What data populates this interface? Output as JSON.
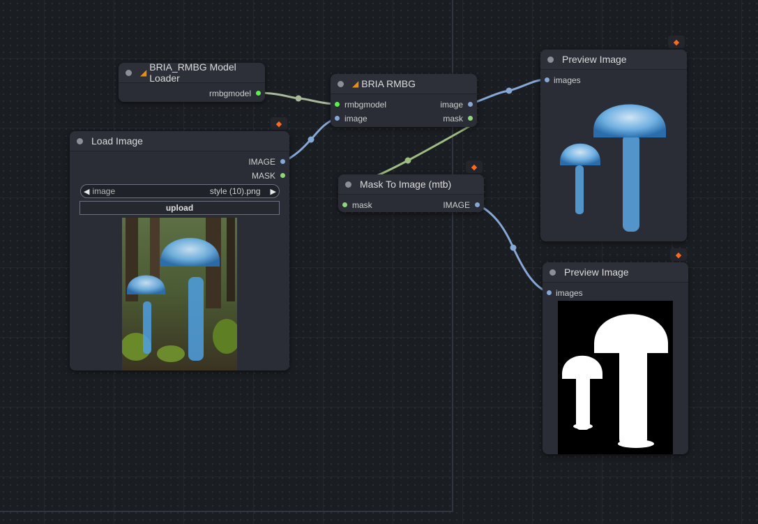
{
  "nodes": {
    "loader": {
      "title": "BRIA_RMBG Model Loader",
      "output": "rmbgmodel"
    },
    "rmbg": {
      "title": "BRIA RMBG",
      "inputs": [
        "rmbgmodel",
        "image"
      ],
      "outputs": [
        "image",
        "mask"
      ]
    },
    "load_image": {
      "title": "Load Image",
      "outputs": [
        "IMAGE",
        "MASK"
      ],
      "combo_label": "image",
      "combo_value": "style (10).png",
      "upload_label": "upload"
    },
    "mask_to_image": {
      "title": "Mask To Image (mtb)",
      "input": "mask",
      "output": "IMAGE"
    },
    "preview1": {
      "title": "Preview Image",
      "input": "images"
    },
    "preview2": {
      "title": "Preview Image",
      "input": "images"
    }
  },
  "badge_icon": "fox-icon",
  "colors": {
    "image_link": "#86a8d6",
    "mask_link": "#9dbd82",
    "model_link": "#a8b99a",
    "badge": "#ff6a1a"
  }
}
